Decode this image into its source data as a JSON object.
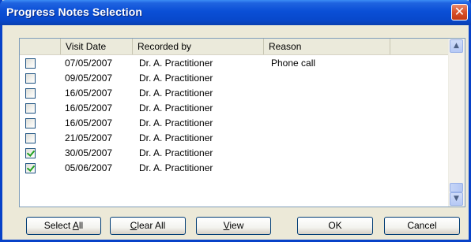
{
  "window": {
    "title": "Progress Notes Selection",
    "close_glyph": "✕"
  },
  "columns": {
    "check": "",
    "visit_date": "Visit Date",
    "recorded_by": "Recorded by",
    "reason": "Reason",
    "extra": ""
  },
  "rows": [
    {
      "checked": false,
      "visit_date": "07/05/2007",
      "recorded_by": "Dr. A. Practitioner",
      "reason": "Phone call"
    },
    {
      "checked": false,
      "visit_date": "09/05/2007",
      "recorded_by": "Dr. A. Practitioner",
      "reason": ""
    },
    {
      "checked": false,
      "visit_date": "16/05/2007",
      "recorded_by": "Dr. A. Practitioner",
      "reason": ""
    },
    {
      "checked": false,
      "visit_date": "16/05/2007",
      "recorded_by": "Dr. A. Practitioner",
      "reason": ""
    },
    {
      "checked": false,
      "visit_date": "16/05/2007",
      "recorded_by": "Dr. A. Practitioner",
      "reason": ""
    },
    {
      "checked": false,
      "visit_date": "21/05/2007",
      "recorded_by": "Dr. A. Practitioner",
      "reason": ""
    },
    {
      "checked": true,
      "visit_date": "30/05/2007",
      "recorded_by": "Dr. A. Practitioner",
      "reason": ""
    },
    {
      "checked": true,
      "visit_date": "05/06/2007",
      "recorded_by": "Dr. A. Practitioner",
      "reason": ""
    }
  ],
  "buttons": {
    "select_all": {
      "pre": "Select ",
      "key": "A",
      "post": "ll"
    },
    "clear_all": {
      "pre": "",
      "key": "C",
      "post": "lear All"
    },
    "view": {
      "pre": "",
      "key": "V",
      "post": "iew"
    },
    "ok": "OK",
    "cancel": "Cancel"
  },
  "icons": {
    "scroll_up": "▲",
    "scroll_down": "▼",
    "check_color": "#21a121",
    "titlebar_color": "#0a4fd6",
    "close_color": "#d8512a"
  }
}
